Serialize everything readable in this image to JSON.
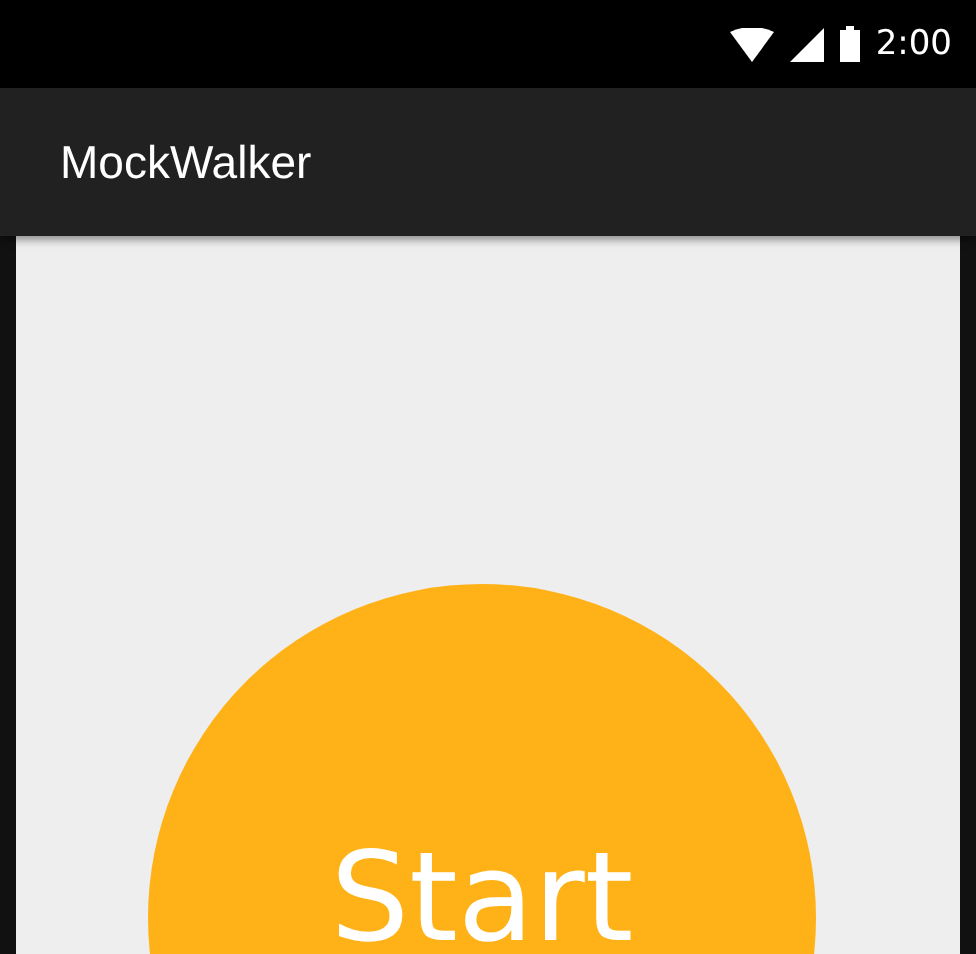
{
  "status_bar": {
    "time": "2:00"
  },
  "app_bar": {
    "title": "MockWalker"
  },
  "start_button": {
    "label": "Start"
  }
}
